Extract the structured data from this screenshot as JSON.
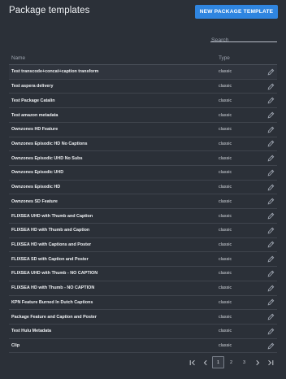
{
  "header": {
    "title": "Package templates",
    "new_button_label": "NEW PACKAGE TEMPLATE"
  },
  "search": {
    "placeholder": "Search",
    "value": ""
  },
  "table": {
    "columns": {
      "name": "Name",
      "type": "Type"
    },
    "rows": [
      {
        "name": "Test transcode+concat+caption transform",
        "type": "classic"
      },
      {
        "name": "Test aspera delivery",
        "type": "classic"
      },
      {
        "name": "Test Package Catalin",
        "type": "classic"
      },
      {
        "name": "Test amazon metadata",
        "type": "classic"
      },
      {
        "name": "Ownzones HD Feature",
        "type": "classic"
      },
      {
        "name": "Ownzones Episodic HD No Captions",
        "type": "classic"
      },
      {
        "name": "Ownzones Episodic UHD No Subs",
        "type": "classic"
      },
      {
        "name": "Ownzones Episodic UHD",
        "type": "classic"
      },
      {
        "name": "Ownzones Episodic HD",
        "type": "classic"
      },
      {
        "name": "Ownzones SD Feature",
        "type": "classic"
      },
      {
        "name": "FLIXSEA UHD with Thumb and Caption",
        "type": "classic"
      },
      {
        "name": "FLIXSEA HD with Thumb and Caption",
        "type": "classic"
      },
      {
        "name": "FLIXSEA HD with Captions and Poster",
        "type": "classic"
      },
      {
        "name": "FLIXSEA SD with Caption and Poster",
        "type": "classic"
      },
      {
        "name": "FLIXSEA UHD with Thumb - NO CAPTION",
        "type": "classic"
      },
      {
        "name": "FLIXSEA HD with Thumb - NO CAPTION",
        "type": "classic"
      },
      {
        "name": "KPN Feature Burned In Dutch Captions",
        "type": "classic"
      },
      {
        "name": "Package Feature and Caption and Poster",
        "type": "classic"
      },
      {
        "name": "Test Hulu Metadata",
        "type": "classic"
      },
      {
        "name": "Clip",
        "type": "classic"
      }
    ]
  },
  "pagination": {
    "pages": [
      "1",
      "2",
      "3"
    ],
    "current_page": "1"
  },
  "icons": {
    "row_action": "pencil-icon",
    "first": "first-page-icon",
    "prev": "chevron-left-icon",
    "next": "chevron-right-icon",
    "last": "last-page-icon"
  },
  "colors": {
    "background": "#2b3038",
    "accent": "#2f85e0",
    "row_divider": "#3f444d"
  }
}
